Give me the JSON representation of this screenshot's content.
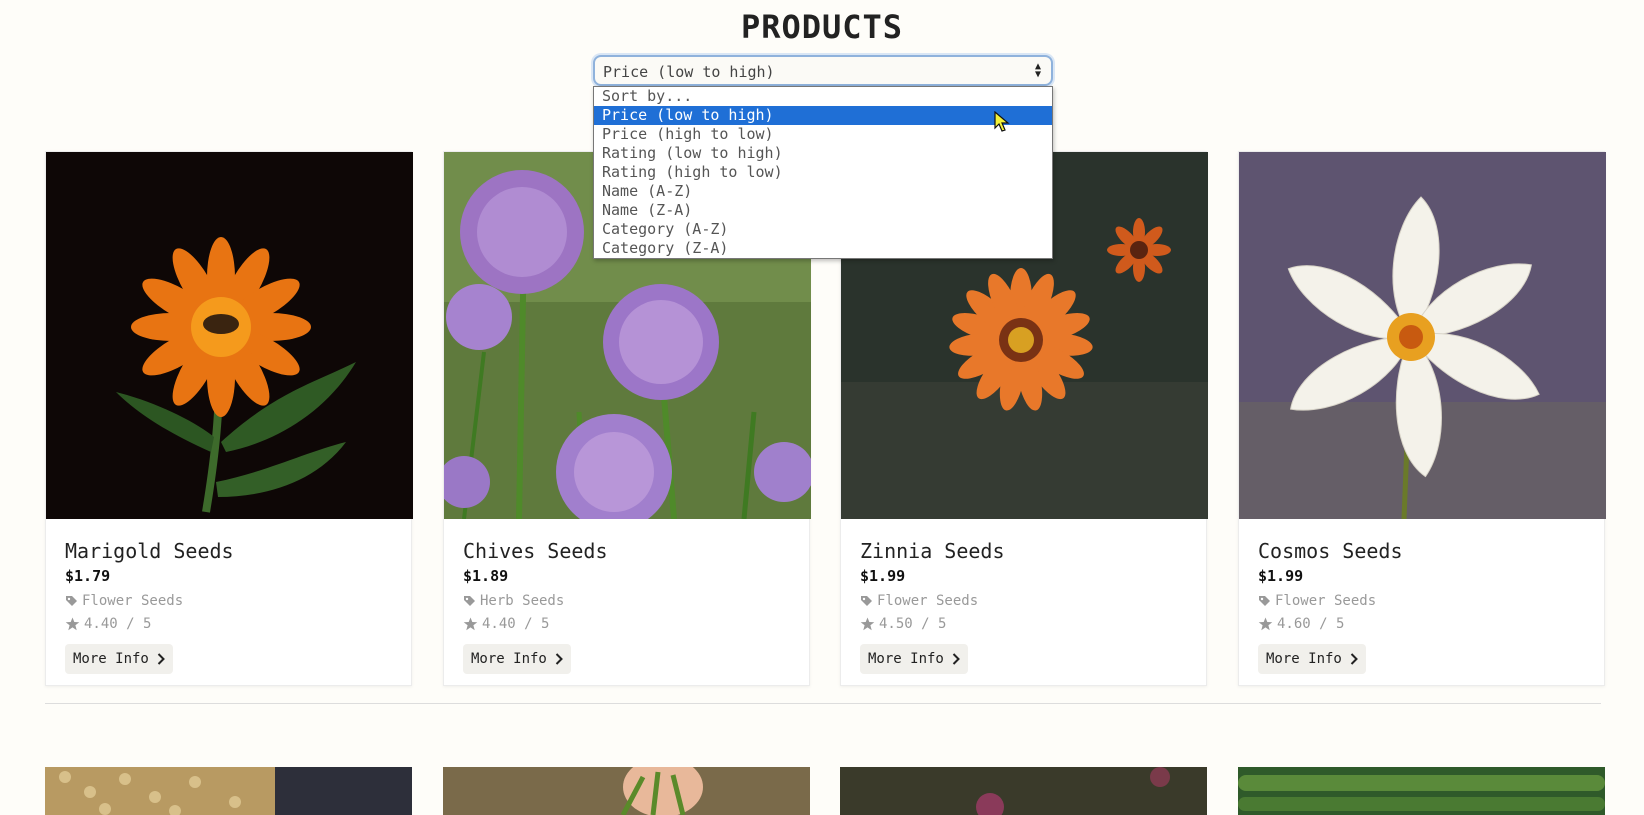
{
  "page": {
    "title": "PRODUCTS"
  },
  "sort": {
    "selected": "Price (low to high)",
    "options": [
      "Sort by...",
      "Price (low to high)",
      "Price (high to low)",
      "Rating (low to high)",
      "Rating (high to low)",
      "Name (A-Z)",
      "Name (Z-A)",
      "Category (A-Z)",
      "Category (Z-A)"
    ]
  },
  "products": [
    {
      "name": "Marigold Seeds",
      "price": "$1.79",
      "category": "Flower Seeds",
      "rating": "4.40 / 5",
      "button": "More Info"
    },
    {
      "name": "Chives Seeds",
      "price": "$1.89",
      "category": "Herb Seeds",
      "rating": "4.40 / 5",
      "button": "More Info"
    },
    {
      "name": "Zinnia Seeds",
      "price": "$1.99",
      "category": "Flower Seeds",
      "rating": "4.50 / 5",
      "button": "More Info"
    },
    {
      "name": "Cosmos Seeds",
      "price": "$1.99",
      "category": "Flower Seeds",
      "rating": "4.60 / 5",
      "button": "More Info"
    }
  ],
  "colors": {
    "selected_option": "#1f6fd6",
    "background": "#fefdf9"
  },
  "icons": {
    "category": "tag-icon",
    "rating": "star-icon",
    "button": "chevron-right-icon",
    "select": "sort-arrows-icon"
  }
}
